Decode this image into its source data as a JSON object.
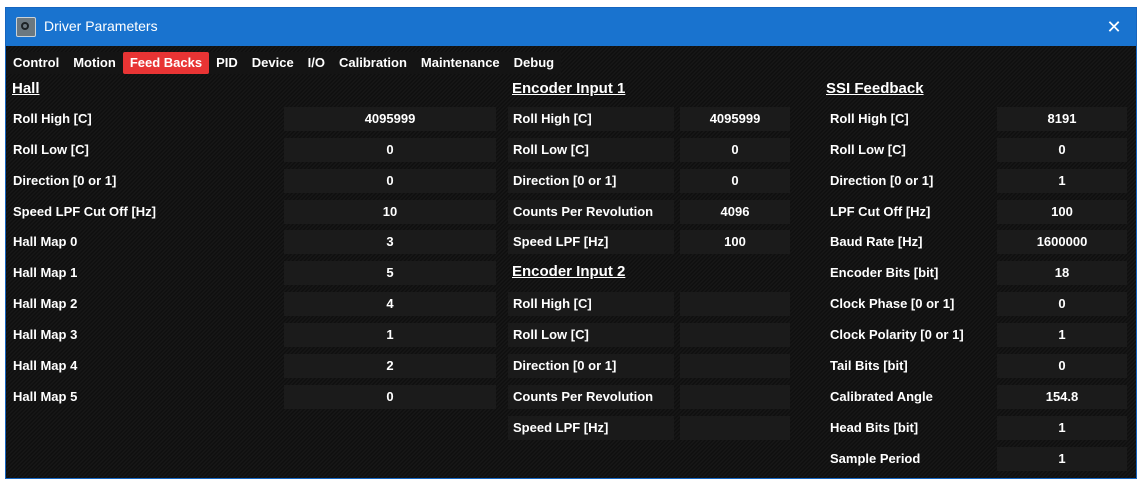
{
  "window": {
    "title": "Driver Parameters",
    "close_glyph": "✕",
    "icon": "app-gear-icon"
  },
  "tabs": [
    "Control",
    "Motion",
    "Feed Backs",
    "PID",
    "Device",
    "I/O",
    "Calibration",
    "Maintenance",
    "Debug"
  ],
  "active_tab": "Feed Backs",
  "colors": {
    "titlebar": "#1973cf",
    "active_tab": "#e83434",
    "background": "#0f0f0f"
  },
  "hall": {
    "title": "Hall",
    "rows": [
      {
        "label": "Roll High [C]",
        "value": "4095999"
      },
      {
        "label": "Roll Low [C]",
        "value": "0"
      },
      {
        "label": "Direction [0 or 1]",
        "value": "0"
      },
      {
        "label": "Speed LPF Cut Off [Hz]",
        "value": "10"
      },
      {
        "label": "Hall Map 0",
        "value": "3"
      },
      {
        "label": "Hall Map 1",
        "value": "5"
      },
      {
        "label": "Hall Map 2",
        "value": "4"
      },
      {
        "label": "Hall Map 3",
        "value": "1"
      },
      {
        "label": "Hall Map 4",
        "value": "2"
      },
      {
        "label": "Hall Map 5",
        "value": "0"
      }
    ]
  },
  "encoder1": {
    "title": "Encoder Input 1",
    "rows": [
      {
        "label": "Roll High [C]",
        "value": "4095999"
      },
      {
        "label": "Roll Low [C]",
        "value": "0"
      },
      {
        "label": "Direction [0 or 1]",
        "value": "0"
      },
      {
        "label": "Counts Per Revolution",
        "value": "4096"
      },
      {
        "label": "Speed LPF [Hz]",
        "value": "100"
      }
    ]
  },
  "encoder2": {
    "title": "Encoder Input 2",
    "rows": [
      {
        "label": "Roll High [C]",
        "value": ""
      },
      {
        "label": "Roll Low [C]",
        "value": ""
      },
      {
        "label": "Direction [0 or 1]",
        "value": ""
      },
      {
        "label": "Counts Per Revolution",
        "value": ""
      },
      {
        "label": "Speed LPF [Hz]",
        "value": ""
      }
    ]
  },
  "ssi": {
    "title": "SSI Feedback",
    "rows": [
      {
        "label": "Roll High [C]",
        "value": "8191"
      },
      {
        "label": "Roll Low [C]",
        "value": "0"
      },
      {
        "label": "Direction [0 or 1]",
        "value": "1"
      },
      {
        "label": "LPF Cut Off [Hz]",
        "value": "100"
      },
      {
        "label": "Baud Rate [Hz]",
        "value": "1600000"
      },
      {
        "label": "Encoder Bits [bit]",
        "value": "18"
      },
      {
        "label": "Clock Phase [0 or 1]",
        "value": "0"
      },
      {
        "label": "Clock Polarity [0 or 1]",
        "value": "1"
      },
      {
        "label": "Tail Bits [bit]",
        "value": "0"
      },
      {
        "label": "Calibrated Angle",
        "value": "154.8"
      },
      {
        "label": "Head Bits [bit]",
        "value": "1"
      },
      {
        "label": "Sample Period",
        "value": "1"
      }
    ]
  }
}
